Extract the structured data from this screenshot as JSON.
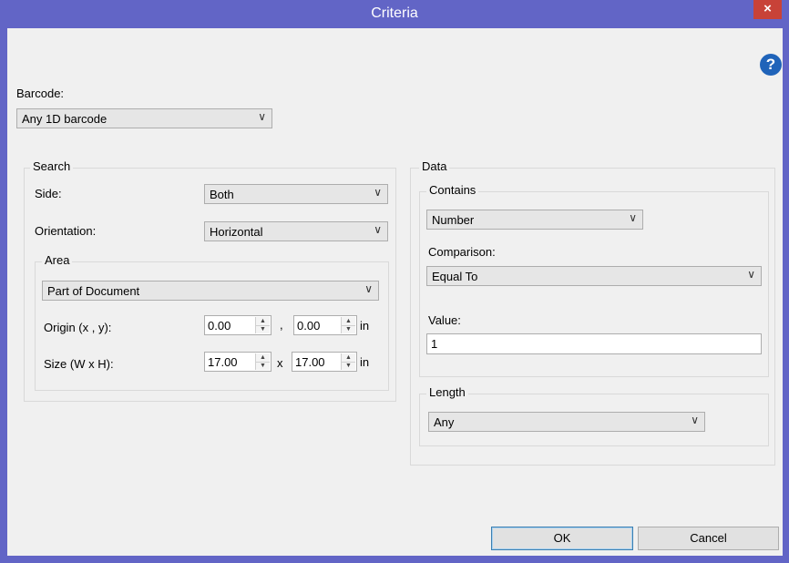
{
  "window": {
    "title": "Criteria",
    "close_glyph": "×",
    "help_glyph": "?"
  },
  "barcode": {
    "label": "Barcode:",
    "value": "Any 1D barcode"
  },
  "search": {
    "title": "Search",
    "side_label": "Side:",
    "side_value": "Both",
    "orientation_label": "Orientation:",
    "orientation_value": "Horizontal",
    "area": {
      "title": "Area",
      "value": "Part of Document",
      "origin_label": "Origin (x , y):",
      "origin_x": "0.00",
      "origin_sep": ",",
      "origin_y": "0.00",
      "origin_unit": "in",
      "size_label": "Size (W x H):",
      "size_w": "17.00",
      "size_sep": "x",
      "size_h": "17.00",
      "size_unit": "in"
    }
  },
  "data": {
    "title": "Data",
    "contains": {
      "title": "Contains",
      "value": "Number",
      "comparison_label": "Comparison:",
      "comparison_value": "Equal To",
      "value_label": "Value:",
      "value_input": "1"
    },
    "length": {
      "title": "Length",
      "value": "Any"
    }
  },
  "buttons": {
    "ok": "OK",
    "cancel": "Cancel"
  },
  "chevron": "∨"
}
